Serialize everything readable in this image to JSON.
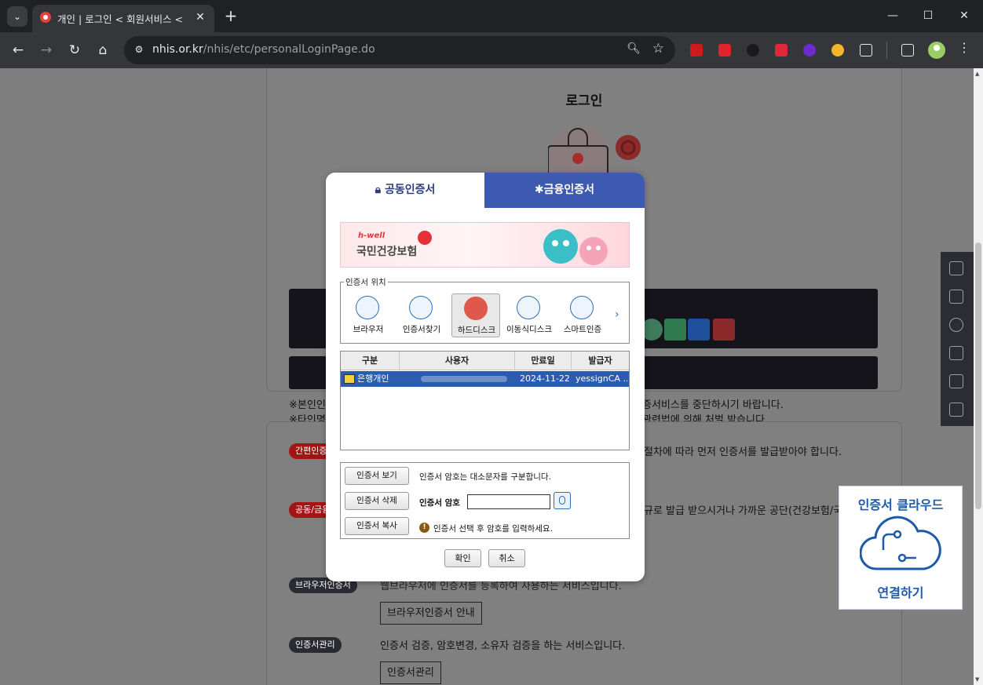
{
  "browser": {
    "tab_title": "개인 | 로그인 < 회원서비스 <",
    "url_host": "nhis.or.kr",
    "url_path": "/nhis/etc/personalLoginPage.do",
    "icons": {
      "tab_search": "chevron-down-icon",
      "close": "close-icon",
      "new_tab": "plus-icon",
      "back": "arrow-left-icon",
      "forward": "arrow-right-icon",
      "reload": "reload-icon",
      "home": "home-icon"
    }
  },
  "page": {
    "login_title": "로그인",
    "notice1_left": "※본인인",
    "notice1_right": "증서비스를 중단하시기 바랍니다.",
    "notice2_left": "※타인명",
    "notice2_right": "관련법에 의해 처벌 받습니다.",
    "sections": [
      {
        "badge": "간편인증",
        "desc": "절차에 따라 먼저 인증서를 발급받아야 합니다."
      },
      {
        "badge": "공동/금융",
        "desc": "규로 발급 받으시거나 가까운 공단(건강보험/국민연금)으"
      },
      {
        "badge": "브라우저인증서",
        "desc": "웹브라우저에 인증서를 등록하여 사용하는 서비스입니다.",
        "button": "브라우저인증서 안내"
      },
      {
        "badge": "인증서관리",
        "desc": "인증서 검증, 암호변경, 소유자 검증을 하는 서비스입니다.",
        "button": "인증서관리"
      }
    ]
  },
  "cloud_widget": {
    "title": "인증서 클라우드",
    "action": "연결하기"
  },
  "modal": {
    "tab_joint": "공동인증서",
    "tab_financial": "금융인증서",
    "banner": {
      "brand": "h-well",
      "name": "국민건강보험"
    },
    "location_legend": "인증서 위치",
    "locations": [
      "브라우저",
      "인증서찾기",
      "하드디스크",
      "이동식디스크",
      "스마트인증"
    ],
    "selected_location": "하드디스크",
    "table": {
      "headers": [
        "구분",
        "사용자",
        "만료일",
        "발급자"
      ],
      "rows": [
        {
          "type": "은행개인",
          "user": "",
          "expiry": "2024-11-22",
          "issuer": "yessignCA ..."
        }
      ]
    },
    "buttons": {
      "view": "인증서 보기",
      "delete": "인증서 삭제",
      "copy": "인증서 복사",
      "confirm": "확인",
      "cancel": "취소"
    },
    "case_notice": "인증서 암호는 대소문자를 구분합니다.",
    "password_label": "인증서 암호",
    "password_value": "",
    "hint": "인증서 선택 후 암호를 입력하세요."
  },
  "colors": {
    "modal_tab_active_text": "#2c3e7a",
    "modal_tab_inactive_bg": "#3e5ab0",
    "selected_row": "#2b5cb0",
    "badge_red": "#a31515",
    "cloud_blue": "#1e5aa8"
  }
}
